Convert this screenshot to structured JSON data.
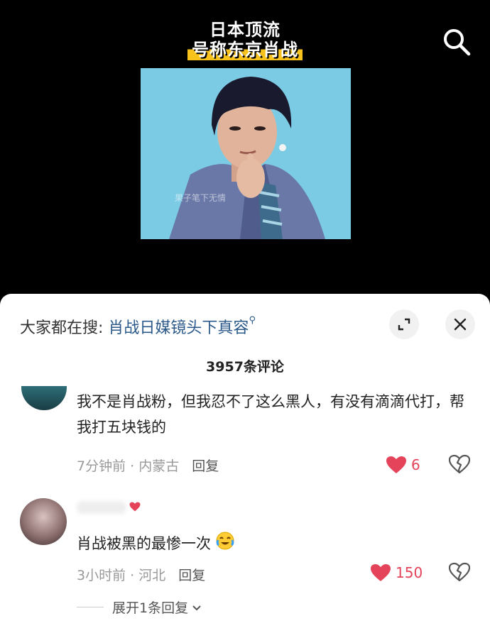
{
  "video": {
    "title_line1": "日本顶流",
    "title_line2": "号称东京肖战",
    "watermark": "果子笔下无情"
  },
  "colors": {
    "accent_like": "#e5435a",
    "link": "#2b5a8a",
    "highlight": "#f7c21c"
  },
  "search_bar": {
    "prefix": "大家都在搜:",
    "query": "肖战日媒镜头下真容",
    "query_icon": "search-icon"
  },
  "comments_count": "3957条评论",
  "comments": [
    {
      "text": "我不是肖战粉，但我忍不了这么黑人，有没有滴滴代打，帮我打五块钱的",
      "time_location": "7分钟前 · 内蒙古",
      "reply_label": "回复",
      "likes": "6"
    },
    {
      "text": "肖战被黑的最惨一次",
      "emoji_icon": "crying-laughing-emoji",
      "time_location": "3小时前 · 河北",
      "reply_label": "回复",
      "likes": "150",
      "expand_replies": "展开1条回复"
    }
  ]
}
